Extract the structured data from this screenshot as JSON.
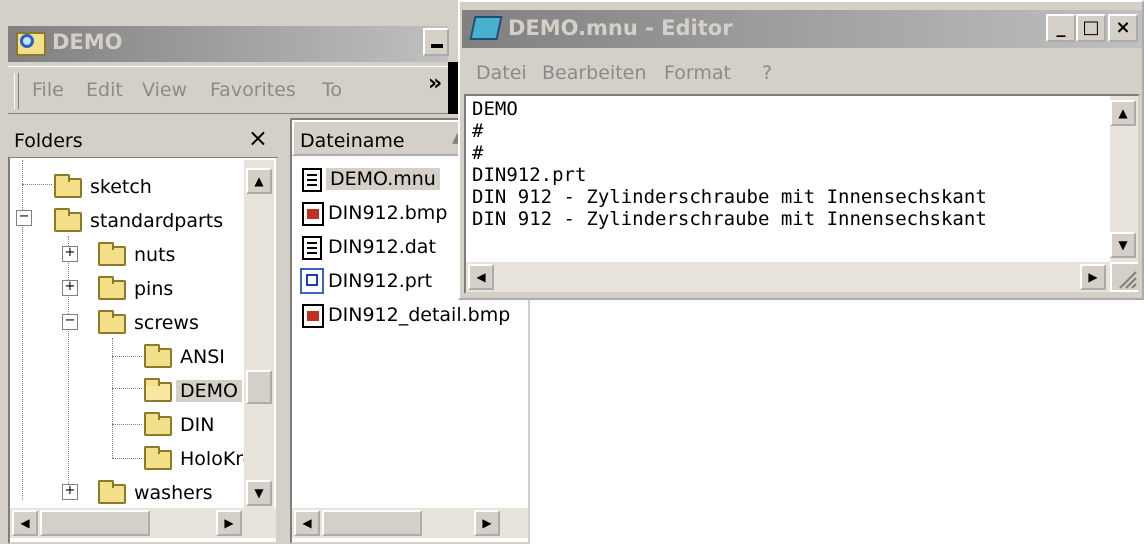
{
  "explorer": {
    "title": "DEMO",
    "menu": [
      "File",
      "Edit",
      "View",
      "Favorites",
      "To"
    ],
    "chevron": "»"
  },
  "folders": {
    "header": "Folders",
    "close": "×",
    "items": [
      {
        "label": "sketch",
        "level": 1,
        "expander": ""
      },
      {
        "label": "standardparts",
        "level": 0,
        "expander": "−"
      },
      {
        "label": "nuts",
        "level": 1,
        "expander": "+"
      },
      {
        "label": "pins",
        "level": 1,
        "expander": "+"
      },
      {
        "label": "screws",
        "level": 1,
        "expander": "−"
      },
      {
        "label": "ANSI",
        "level": 2,
        "expander": ""
      },
      {
        "label": "DEMO",
        "level": 2,
        "expander": "",
        "selected": true
      },
      {
        "label": "DIN",
        "level": 2,
        "expander": ""
      },
      {
        "label": "HoloKro",
        "level": 2,
        "expander": ""
      },
      {
        "label": "washers",
        "level": 1,
        "expander": "+"
      }
    ]
  },
  "files": {
    "column_header": "Dateiname",
    "sort_indicator": "▲",
    "items": [
      {
        "name": "DEMO.mnu",
        "icon": "text-document-icon",
        "selected": true
      },
      {
        "name": "DIN912.bmp",
        "icon": "bitmap-icon"
      },
      {
        "name": "DIN912.dat",
        "icon": "text-document-icon"
      },
      {
        "name": "DIN912.prt",
        "icon": "part-file-icon"
      },
      {
        "name": "DIN912_detail.bmp",
        "icon": "bitmap-icon"
      }
    ]
  },
  "editor": {
    "title": "DEMO.mnu - Editor",
    "menu": [
      "Datei",
      "Bearbeiten",
      "Format",
      "?"
    ],
    "lines": [
      "DEMO",
      "#",
      "#",
      "DIN912.prt",
      "DIN 912 - Zylinderschraube mit Innensechskant",
      "DIN 912 - Zylinderschraube mit Innensechskant"
    ],
    "buttons": {
      "minimize": "_",
      "maximize": "□",
      "close": "×"
    }
  },
  "colors": {
    "inactive_title_start": "#808080",
    "inactive_title_end": "#c0c0c0",
    "face": "#d4d0c8",
    "folder": "#f5e08a"
  }
}
